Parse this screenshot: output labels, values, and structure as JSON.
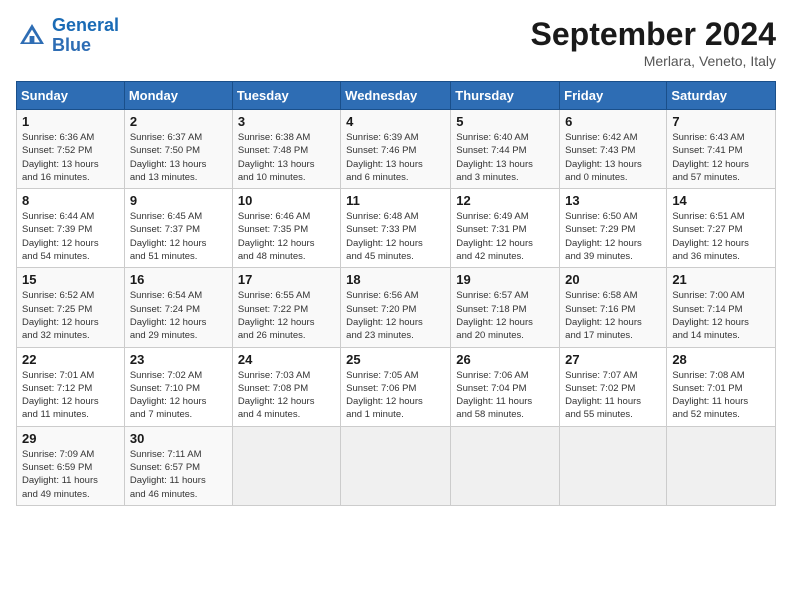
{
  "logo": {
    "line1": "General",
    "line2": "Blue"
  },
  "title": "September 2024",
  "location": "Merlara, Veneto, Italy",
  "days_of_week": [
    "Sunday",
    "Monday",
    "Tuesday",
    "Wednesday",
    "Thursday",
    "Friday",
    "Saturday"
  ],
  "weeks": [
    [
      {
        "num": "1",
        "info": "Sunrise: 6:36 AM\nSunset: 7:52 PM\nDaylight: 13 hours\nand 16 minutes."
      },
      {
        "num": "2",
        "info": "Sunrise: 6:37 AM\nSunset: 7:50 PM\nDaylight: 13 hours\nand 13 minutes."
      },
      {
        "num": "3",
        "info": "Sunrise: 6:38 AM\nSunset: 7:48 PM\nDaylight: 13 hours\nand 10 minutes."
      },
      {
        "num": "4",
        "info": "Sunrise: 6:39 AM\nSunset: 7:46 PM\nDaylight: 13 hours\nand 6 minutes."
      },
      {
        "num": "5",
        "info": "Sunrise: 6:40 AM\nSunset: 7:44 PM\nDaylight: 13 hours\nand 3 minutes."
      },
      {
        "num": "6",
        "info": "Sunrise: 6:42 AM\nSunset: 7:43 PM\nDaylight: 13 hours\nand 0 minutes."
      },
      {
        "num": "7",
        "info": "Sunrise: 6:43 AM\nSunset: 7:41 PM\nDaylight: 12 hours\nand 57 minutes."
      }
    ],
    [
      {
        "num": "8",
        "info": "Sunrise: 6:44 AM\nSunset: 7:39 PM\nDaylight: 12 hours\nand 54 minutes."
      },
      {
        "num": "9",
        "info": "Sunrise: 6:45 AM\nSunset: 7:37 PM\nDaylight: 12 hours\nand 51 minutes."
      },
      {
        "num": "10",
        "info": "Sunrise: 6:46 AM\nSunset: 7:35 PM\nDaylight: 12 hours\nand 48 minutes."
      },
      {
        "num": "11",
        "info": "Sunrise: 6:48 AM\nSunset: 7:33 PM\nDaylight: 12 hours\nand 45 minutes."
      },
      {
        "num": "12",
        "info": "Sunrise: 6:49 AM\nSunset: 7:31 PM\nDaylight: 12 hours\nand 42 minutes."
      },
      {
        "num": "13",
        "info": "Sunrise: 6:50 AM\nSunset: 7:29 PM\nDaylight: 12 hours\nand 39 minutes."
      },
      {
        "num": "14",
        "info": "Sunrise: 6:51 AM\nSunset: 7:27 PM\nDaylight: 12 hours\nand 36 minutes."
      }
    ],
    [
      {
        "num": "15",
        "info": "Sunrise: 6:52 AM\nSunset: 7:25 PM\nDaylight: 12 hours\nand 32 minutes."
      },
      {
        "num": "16",
        "info": "Sunrise: 6:54 AM\nSunset: 7:24 PM\nDaylight: 12 hours\nand 29 minutes."
      },
      {
        "num": "17",
        "info": "Sunrise: 6:55 AM\nSunset: 7:22 PM\nDaylight: 12 hours\nand 26 minutes."
      },
      {
        "num": "18",
        "info": "Sunrise: 6:56 AM\nSunset: 7:20 PM\nDaylight: 12 hours\nand 23 minutes."
      },
      {
        "num": "19",
        "info": "Sunrise: 6:57 AM\nSunset: 7:18 PM\nDaylight: 12 hours\nand 20 minutes."
      },
      {
        "num": "20",
        "info": "Sunrise: 6:58 AM\nSunset: 7:16 PM\nDaylight: 12 hours\nand 17 minutes."
      },
      {
        "num": "21",
        "info": "Sunrise: 7:00 AM\nSunset: 7:14 PM\nDaylight: 12 hours\nand 14 minutes."
      }
    ],
    [
      {
        "num": "22",
        "info": "Sunrise: 7:01 AM\nSunset: 7:12 PM\nDaylight: 12 hours\nand 11 minutes."
      },
      {
        "num": "23",
        "info": "Sunrise: 7:02 AM\nSunset: 7:10 PM\nDaylight: 12 hours\nand 7 minutes."
      },
      {
        "num": "24",
        "info": "Sunrise: 7:03 AM\nSunset: 7:08 PM\nDaylight: 12 hours\nand 4 minutes."
      },
      {
        "num": "25",
        "info": "Sunrise: 7:05 AM\nSunset: 7:06 PM\nDaylight: 12 hours\nand 1 minute."
      },
      {
        "num": "26",
        "info": "Sunrise: 7:06 AM\nSunset: 7:04 PM\nDaylight: 11 hours\nand 58 minutes."
      },
      {
        "num": "27",
        "info": "Sunrise: 7:07 AM\nSunset: 7:02 PM\nDaylight: 11 hours\nand 55 minutes."
      },
      {
        "num": "28",
        "info": "Sunrise: 7:08 AM\nSunset: 7:01 PM\nDaylight: 11 hours\nand 52 minutes."
      }
    ],
    [
      {
        "num": "29",
        "info": "Sunrise: 7:09 AM\nSunset: 6:59 PM\nDaylight: 11 hours\nand 49 minutes."
      },
      {
        "num": "30",
        "info": "Sunrise: 7:11 AM\nSunset: 6:57 PM\nDaylight: 11 hours\nand 46 minutes."
      },
      {
        "num": "",
        "info": ""
      },
      {
        "num": "",
        "info": ""
      },
      {
        "num": "",
        "info": ""
      },
      {
        "num": "",
        "info": ""
      },
      {
        "num": "",
        "info": ""
      }
    ]
  ]
}
